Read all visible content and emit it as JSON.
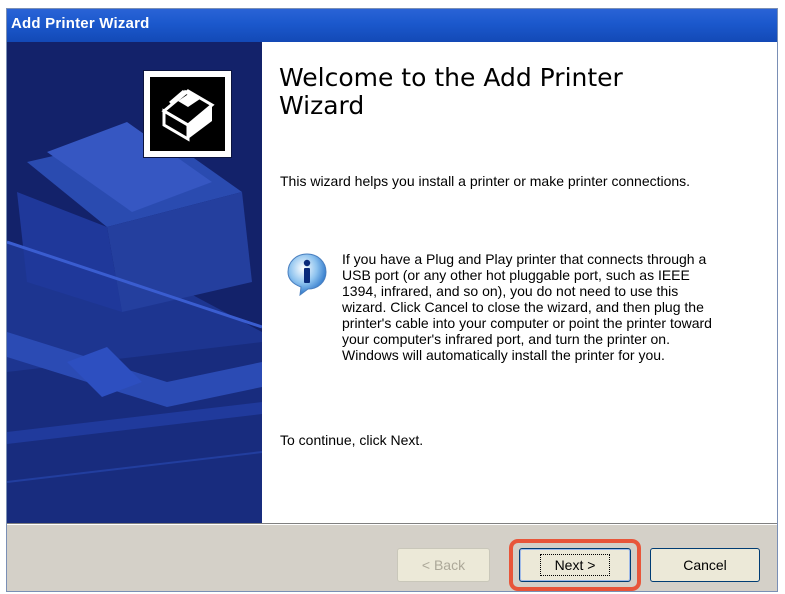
{
  "window": {
    "title": "Add Printer Wizard"
  },
  "content": {
    "heading": "Welcome to the Add Printer Wizard",
    "intro": "This wizard helps you install a printer or make printer connections.",
    "info": {
      "icon": "info-icon",
      "text": "If you have a Plug and Play printer that connects through a USB port (or any other hot pluggable port, such as IEEE 1394, infrared, and so on), you do not need to use this wizard. Click Cancel to close the wizard, and then plug the printer's cable into your computer or point the printer toward your computer's infrared port, and turn the printer on. Windows will automatically install the printer for you."
    },
    "continue": "To continue, click Next."
  },
  "buttons": {
    "back_label": "< Back",
    "next_label": "Next >",
    "cancel_label": "Cancel"
  },
  "colors": {
    "titlebar": "#1b58cc",
    "banner": "#13226a",
    "highlight": "#e8553a",
    "footer": "#d4d0c8"
  }
}
